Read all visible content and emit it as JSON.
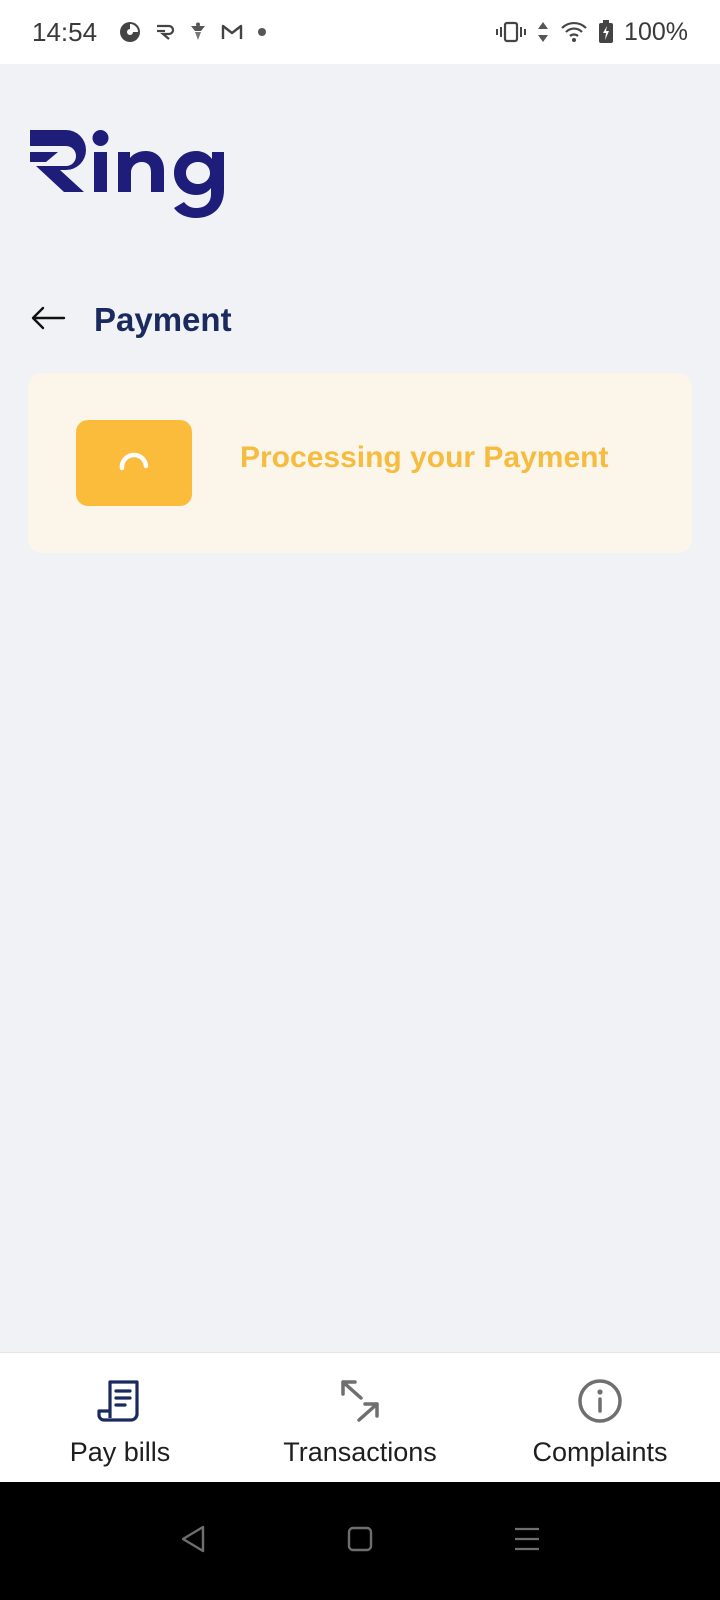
{
  "status_bar": {
    "time": "14:54",
    "battery_percent": "100%",
    "left_icons": [
      "pie-chart-icon",
      "ring-app-icon",
      "vpn-icon",
      "gmail-icon",
      "dot-icon"
    ],
    "right_icons": [
      "vibrate-icon",
      "data-arrows-icon",
      "wifi-icon",
      "battery-charging-icon"
    ]
  },
  "app": {
    "brand": "Ring",
    "brand_color": "#1E1E7A"
  },
  "header": {
    "back_icon": "arrow-left-icon",
    "title": "Payment"
  },
  "processing": {
    "message": "Processing your Payment",
    "spinner_icon": "loading-spinner-icon",
    "accent_color": "#FBBC3C"
  },
  "bottom_nav": {
    "items": [
      {
        "label": "Pay bills",
        "icon": "receipt-icon",
        "active": true
      },
      {
        "label": "Transactions",
        "icon": "transfer-arrows-icon",
        "active": false
      },
      {
        "label": "Complaints",
        "icon": "info-circle-icon",
        "active": false
      }
    ]
  },
  "system_nav": {
    "buttons": [
      "back-triangle-icon",
      "home-square-icon",
      "menu-lines-icon"
    ]
  }
}
